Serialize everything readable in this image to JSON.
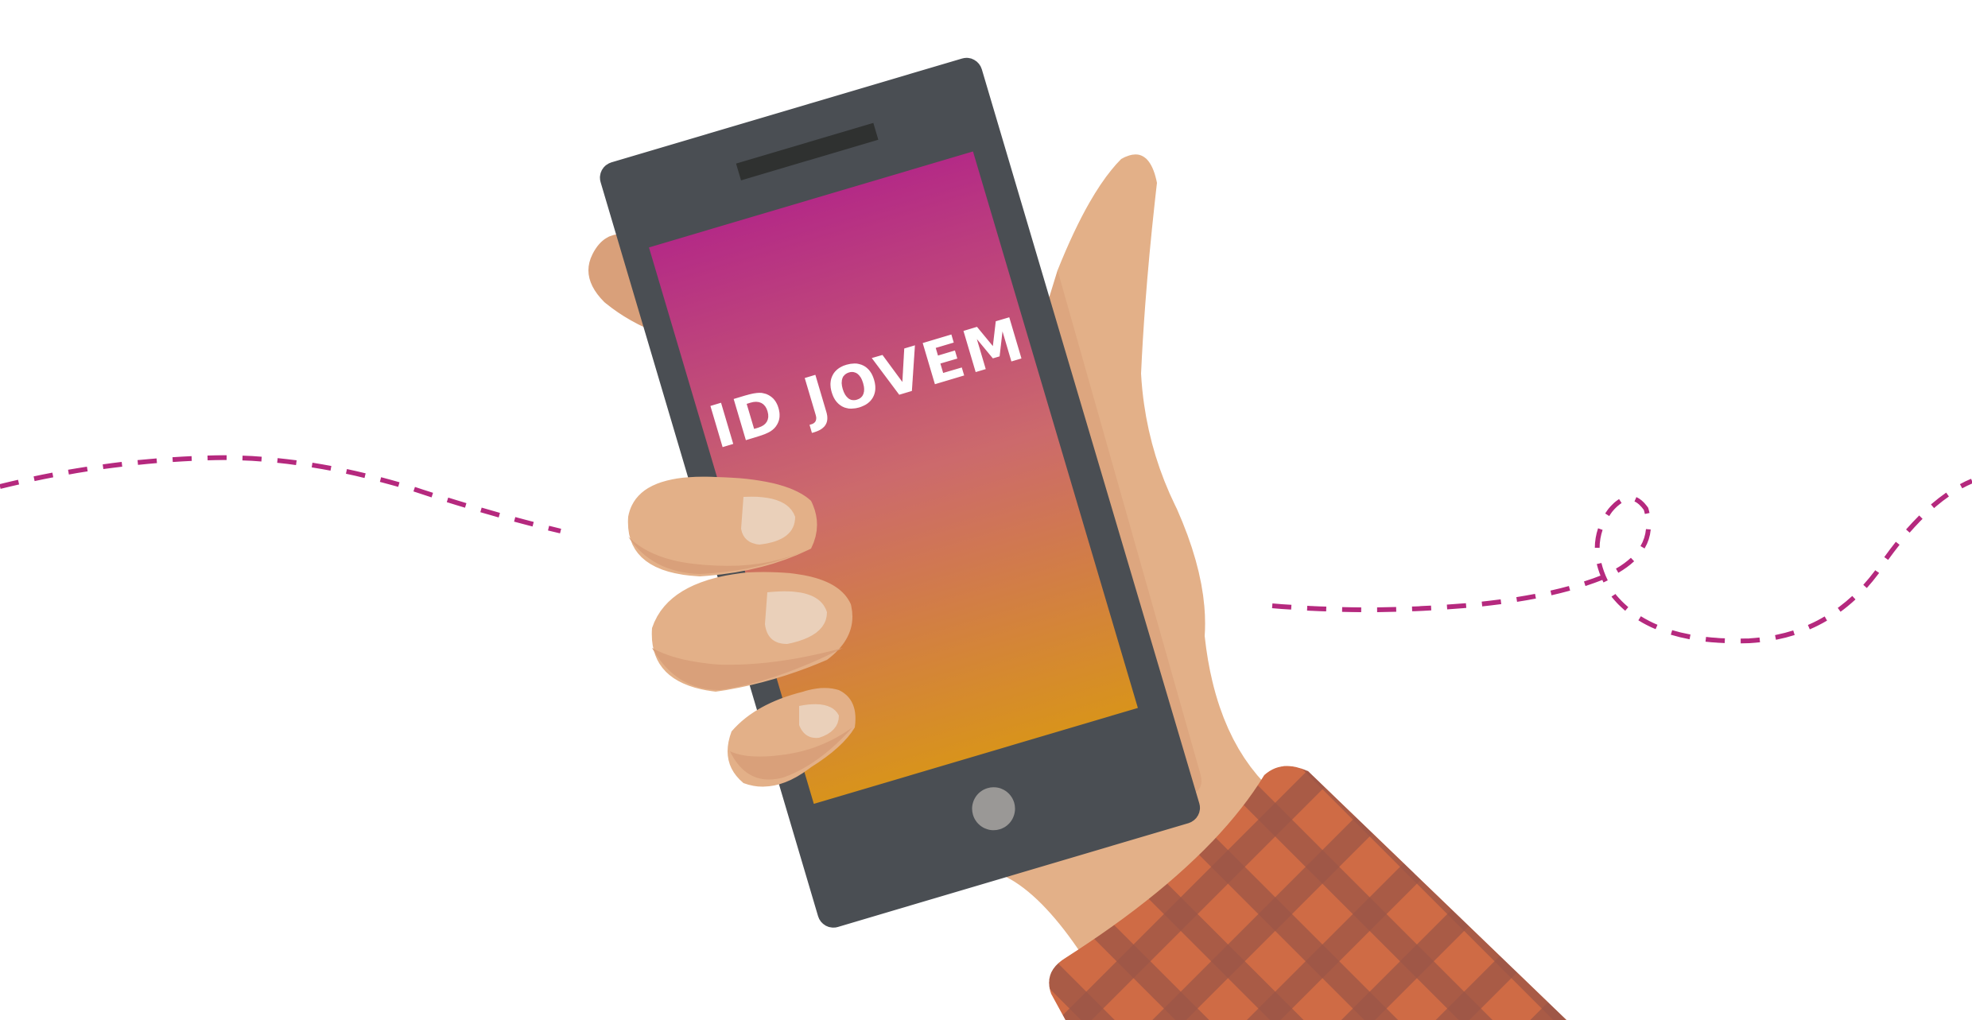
{
  "screen": {
    "title": "ID JOVEM"
  },
  "colors": {
    "background": "#ffffff",
    "dash_line": "#b5297e",
    "phone_body": "#4a4e53",
    "phone_speaker": "#2f3130",
    "phone_home_button": "#9a9896",
    "screen_gradient_top": "#b42a86",
    "screen_gradient_mid": "#cc6a6c",
    "screen_gradient_bottom": "#d8931c",
    "skin": "#e3b088",
    "skin_shadow": "#d9a07a",
    "nail": "#ead0ba",
    "sleeve_base": "#cf6b45",
    "sleeve_check": "#9c5546",
    "title_text": "#ffffff"
  },
  "icons": {
    "home_button": "home-button-icon",
    "speaker": "speaker-icon"
  }
}
